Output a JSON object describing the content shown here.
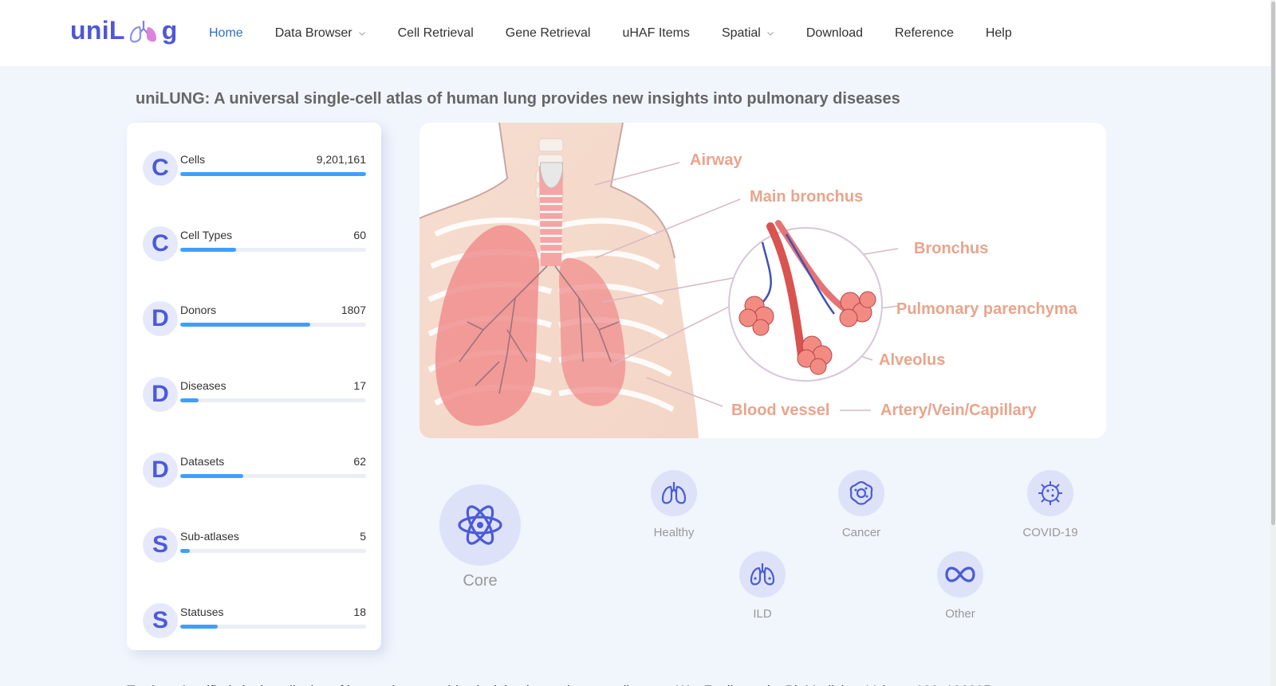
{
  "brand": {
    "name_left": "uniL",
    "name_right": "g",
    "logo_icon": "lungs-icon"
  },
  "nav": {
    "items": [
      {
        "label": "Home",
        "active": true,
        "dropdown": false
      },
      {
        "label": "Data Browser",
        "active": false,
        "dropdown": true
      },
      {
        "label": "Cell Retrieval",
        "active": false,
        "dropdown": false
      },
      {
        "label": "Gene Retrieval",
        "active": false,
        "dropdown": false
      },
      {
        "label": "uHAF Items",
        "active": false,
        "dropdown": false
      },
      {
        "label": "Spatial",
        "active": false,
        "dropdown": true
      },
      {
        "label": "Download",
        "active": false,
        "dropdown": false
      },
      {
        "label": "Reference",
        "active": false,
        "dropdown": false
      },
      {
        "label": "Help",
        "active": false,
        "dropdown": false
      }
    ]
  },
  "page": {
    "title": "uniLUNG: A universal single-cell atlas of human lung provides new insights into pulmonary diseases"
  },
  "stats": [
    {
      "letter": "C",
      "label": "Cells",
      "value": "9,201,161",
      "progress": 1.0
    },
    {
      "letter": "C",
      "label": "Cell Types",
      "value": "60",
      "progress": 0.3
    },
    {
      "letter": "D",
      "label": "Donors",
      "value": "1807",
      "progress": 0.7
    },
    {
      "letter": "D",
      "label": "Diseases",
      "value": "17",
      "progress": 0.1
    },
    {
      "letter": "D",
      "label": "Datasets",
      "value": "62",
      "progress": 0.34
    },
    {
      "letter": "S",
      "label": "Sub-atlases",
      "value": "5",
      "progress": 0.05
    },
    {
      "letter": "S",
      "label": "Statuses",
      "value": "18",
      "progress": 0.2
    }
  ],
  "illustration": {
    "labels": {
      "airway": "Airway",
      "main_bronchus": "Main bronchus",
      "bronchus": "Bronchus",
      "parenchyma": "Pulmonary parenchyma",
      "alveolus": "Alveolus",
      "blood_vessel": "Blood vessel",
      "vessel_types": "Artery/Vein/Capillary"
    },
    "colors": {
      "label": "#e8a58c",
      "lung": "#f08e8e",
      "accent": "#d9534f"
    }
  },
  "atlases": {
    "core": {
      "label": "Core",
      "icon": "atom-icon"
    },
    "items": [
      {
        "label": "Healthy",
        "icon": "lungs-icon"
      },
      {
        "label": "Cancer",
        "icon": "cancer-cell-icon"
      },
      {
        "label": "COVID-19",
        "icon": "virus-icon"
      },
      {
        "label": "ILD",
        "icon": "ild-lungs-icon"
      },
      {
        "label": "Other",
        "icon": "infinity-icon"
      }
    ]
  },
  "citation": {
    "text": "To cite：A unified single-cell atlas of human lung provides insights into pulmonary diseases.Wu, Fanjie et al. eBioMedicine, Volume 122, 106025"
  },
  "theme": {
    "primary": "#4f57d6",
    "nav_active": "#2f6fc7",
    "progress": "#409eff",
    "badge_bg": "#e6e9fb"
  }
}
